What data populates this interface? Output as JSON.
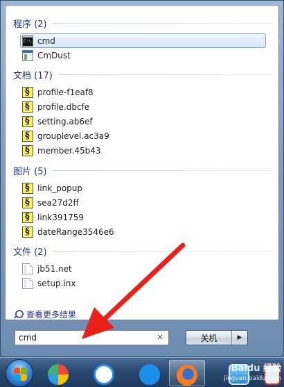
{
  "groups": [
    {
      "header": "程序 (2)",
      "items": [
        {
          "label": "cmd",
          "icon": "cmd-icon",
          "selected": true
        },
        {
          "label": "CmDust",
          "icon": "app-icon"
        }
      ]
    },
    {
      "header": "文档 (17)",
      "items": [
        {
          "label": "profile-f1eaf8",
          "icon": "script-file-icon"
        },
        {
          "label": "profile.dbcfe",
          "icon": "script-file-icon"
        },
        {
          "label": "setting.ab6ef",
          "icon": "script-file-icon"
        },
        {
          "label": "grouplevel.ac3a9",
          "icon": "script-file-icon"
        },
        {
          "label": "member.45b43",
          "icon": "script-file-icon"
        }
      ]
    },
    {
      "header": "图片 (5)",
      "items": [
        {
          "label": "link_popup",
          "icon": "script-file-icon"
        },
        {
          "label": "sea27d2ff",
          "icon": "script-file-icon"
        },
        {
          "label": "link391759",
          "icon": "script-file-icon"
        },
        {
          "label": "dateRange3546e6",
          "icon": "script-file-icon"
        }
      ]
    },
    {
      "header": "文件 (2)",
      "items": [
        {
          "label": "jb51.net",
          "icon": "blank-file-icon"
        },
        {
          "label": "setup.inx",
          "icon": "blank-file-icon"
        }
      ]
    }
  ],
  "see_more": "查看更多结果",
  "search": {
    "value": "cmd",
    "clear_glyph": "×"
  },
  "shutdown": {
    "label": "关机",
    "arrow_glyph": "▶"
  },
  "watermark": {
    "title": "Baidu 经验",
    "sub": "jingyan.baidu.com"
  },
  "colors": {
    "selection_border": "#84acdd",
    "header_text": "#1e3287",
    "annotation_arrow": "#e8221b"
  }
}
